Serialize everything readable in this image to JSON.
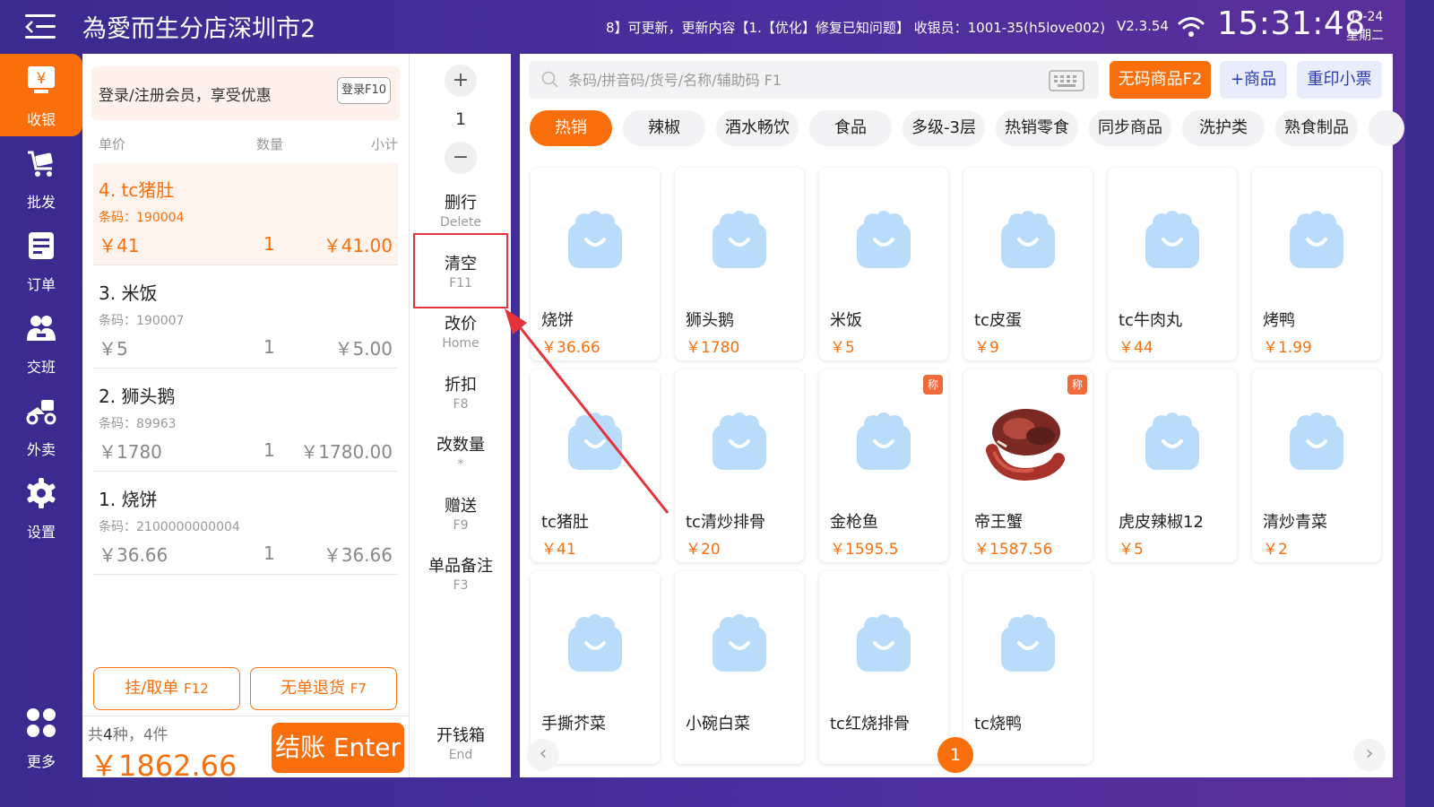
{
  "header": {
    "store_name": "為愛而生分店深圳市2",
    "notice": "8】可更新，更新内容【1.【优化】修复已知问题】 收银员：1001-35(h5love002)",
    "version": "V2.3.54",
    "time": "15:31:48",
    "date": "03-24",
    "weekday": "星期二"
  },
  "nav": [
    {
      "label": "收银",
      "icon": "cashier-icon"
    },
    {
      "label": "批发",
      "icon": "wholesale-cart-icon"
    },
    {
      "label": "订单",
      "icon": "order-icon"
    },
    {
      "label": "交班",
      "icon": "shift-handover-icon"
    },
    {
      "label": "外卖",
      "icon": "delivery-scooter-icon"
    },
    {
      "label": "设置",
      "icon": "gear-icon"
    },
    {
      "label": "更多",
      "icon": "more-grid-icon"
    }
  ],
  "cart": {
    "member_prompt": "登录/注册会员，享受优惠",
    "login_label": "登录F10",
    "columns": {
      "price": "单价",
      "qty": "数量",
      "subtotal": "小计"
    },
    "items": [
      {
        "name": "4. tc猪肚",
        "barcode": "条码：190004",
        "price": "￥41",
        "qty": "1",
        "subtotal": "￥41.00",
        "selected": true
      },
      {
        "name": "3. 米饭",
        "barcode": "条码：190007",
        "price": "￥5",
        "qty": "1",
        "subtotal": "￥5.00",
        "selected": false
      },
      {
        "name": "2. 狮头鹅",
        "barcode": "条码：89963",
        "price": "￥1780",
        "qty": "1",
        "subtotal": "￥1780.00",
        "selected": false
      },
      {
        "name": "1. 烧饼",
        "barcode": "条码：2100000000004",
        "price": "￥36.66",
        "qty": "1",
        "subtotal": "￥36.66",
        "selected": false
      }
    ],
    "hold_label": "挂/取单",
    "hold_key": "F12",
    "refund_label": "无单退货",
    "refund_key": "F7",
    "summary_prefix": "共",
    "summary_kinds": "4",
    "summary_suffix": "种，4件",
    "total": "￥1862.66",
    "checkout_label": "结账 Enter"
  },
  "functions": {
    "plus": "+",
    "qty": "1",
    "minus": "−",
    "buttons": [
      {
        "label": "删行",
        "key": "Delete"
      },
      {
        "label": "清空",
        "key": "F11"
      },
      {
        "label": "改价",
        "key": "Home"
      },
      {
        "label": "折扣",
        "key": "F8"
      },
      {
        "label": "改数量",
        "key": "*"
      },
      {
        "label": "赠送",
        "key": "F9"
      },
      {
        "label": "单品备注",
        "key": "F3"
      }
    ],
    "drawer": {
      "label": "开钱箱",
      "key": "End"
    }
  },
  "products_panel": {
    "search_placeholder": "条码/拼音码/货号/名称/辅助码 F1",
    "no_code_label": "无码商品F2",
    "add_product_label": "+商品",
    "reprint_label": "重印小票",
    "categories": [
      "热销",
      "辣椒",
      "酒水畅饮",
      "食品",
      "多级-3层",
      "热销零食",
      "同步商品",
      "洗护类",
      "熟食制品"
    ],
    "active_category": "热销",
    "weigh_badge": "称",
    "items": [
      {
        "name": "烧饼",
        "price": "￥36.66",
        "weigh": false,
        "photo": false
      },
      {
        "name": "狮头鹅",
        "price": "￥1780",
        "weigh": false,
        "photo": false
      },
      {
        "name": "米饭",
        "price": "￥5",
        "weigh": false,
        "photo": false
      },
      {
        "name": "tc皮蛋",
        "price": "￥9",
        "weigh": false,
        "photo": false
      },
      {
        "name": "tc牛肉丸",
        "price": "￥44",
        "weigh": false,
        "photo": false
      },
      {
        "name": "烤鸭",
        "price": "￥1.99",
        "weigh": false,
        "photo": false
      },
      {
        "name": "tc猪肚",
        "price": "￥41",
        "weigh": false,
        "photo": false
      },
      {
        "name": "tc清炒排骨",
        "price": "￥20",
        "weigh": false,
        "photo": false
      },
      {
        "name": "金枪鱼",
        "price": "￥1595.5",
        "weigh": true,
        "photo": false
      },
      {
        "name": "帝王蟹",
        "price": "￥1587.56",
        "weigh": true,
        "photo": true
      },
      {
        "name": "虎皮辣椒12",
        "price": "￥5",
        "weigh": false,
        "photo": false
      },
      {
        "name": "清炒青菜",
        "price": "￥2",
        "weigh": false,
        "photo": false
      },
      {
        "name": "手撕芥菜",
        "price": "",
        "weigh": false,
        "photo": false
      },
      {
        "name": "小碗白菜",
        "price": "",
        "weigh": false,
        "photo": false
      },
      {
        "name": "tc红烧排骨",
        "price": "",
        "weigh": false,
        "photo": false
      },
      {
        "name": "tc烧鸭",
        "price": "",
        "weigh": false,
        "photo": false
      }
    ],
    "page": "1"
  },
  "colors": {
    "accent": "#f96f0c",
    "nav_bg": "#3b2a8f",
    "highlight": "#e5323b",
    "placeholder_icon": "#b9dcfb"
  }
}
